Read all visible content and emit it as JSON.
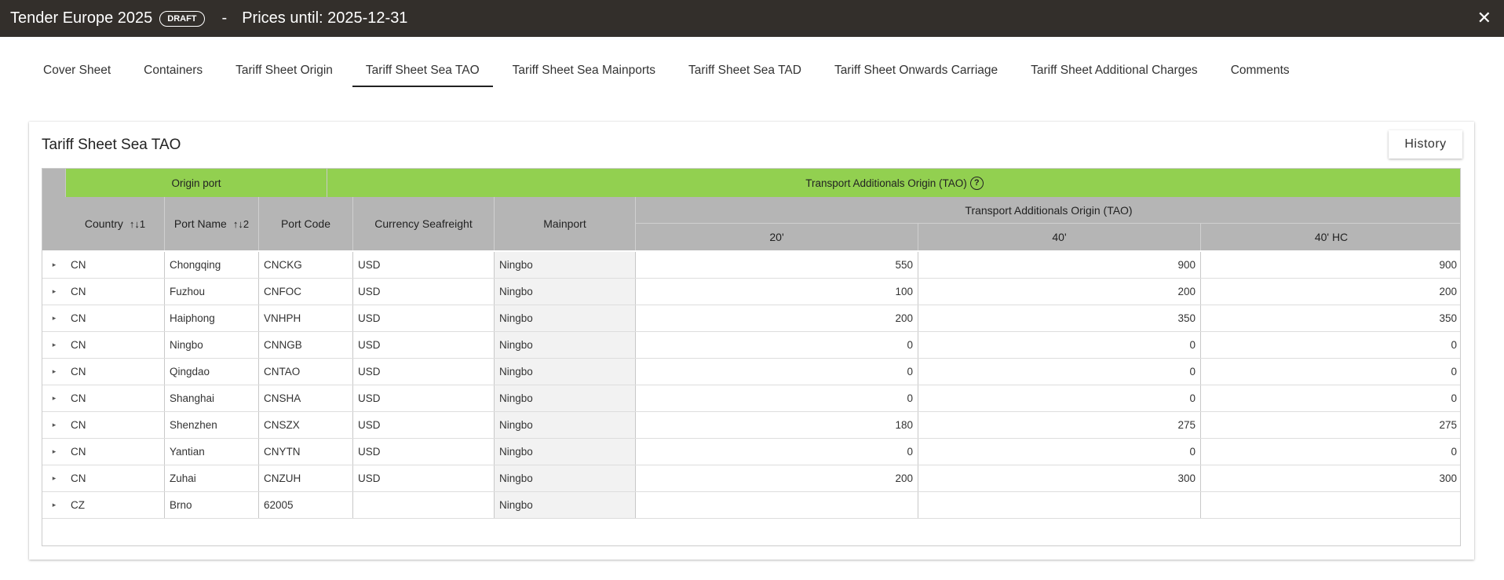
{
  "header": {
    "title": "Tender Europe 2025",
    "badge": "DRAFT",
    "separator": "-",
    "prices": "Prices until: 2025-12-31",
    "close_icon": "close-icon"
  },
  "tabs": [
    {
      "label": "Cover Sheet"
    },
    {
      "label": "Containers"
    },
    {
      "label": "Tariff Sheet Origin"
    },
    {
      "label": "Tariff Sheet Sea TAO",
      "active": true
    },
    {
      "label": "Tariff Sheet Sea Mainports"
    },
    {
      "label": "Tariff Sheet Sea TAD"
    },
    {
      "label": "Tariff Sheet Onwards Carriage"
    },
    {
      "label": "Tariff Sheet Additional Charges"
    },
    {
      "label": "Comments"
    }
  ],
  "card": {
    "title": "Tariff Sheet Sea TAO",
    "history_label": "History"
  },
  "table": {
    "group_origin": "Origin port",
    "group_tao": "Transport Additionals Origin (TAO)",
    "col_country": "Country",
    "col_country_sort": "↑↓1",
    "col_port_name": "Port Name",
    "col_port_name_sort": "↑↓2",
    "col_port_code": "Port Code",
    "col_currency": "Currency Seafreight",
    "col_mainport": "Mainport",
    "sub_group_tao": "Transport Additionals Origin (TAO)",
    "col_20": "20'",
    "col_40": "40'",
    "col_40hc": "40' HC",
    "rows": [
      {
        "country": "CN",
        "port": "Chongqing",
        "code": "CNCKG",
        "currency": "USD",
        "mainport": "Ningbo",
        "v20": "550",
        "v40": "900",
        "v40hc": "900"
      },
      {
        "country": "CN",
        "port": "Fuzhou",
        "code": "CNFOC",
        "currency": "USD",
        "mainport": "Ningbo",
        "v20": "100",
        "v40": "200",
        "v40hc": "200"
      },
      {
        "country": "CN",
        "port": "Haiphong",
        "code": "VNHPH",
        "currency": "USD",
        "mainport": "Ningbo",
        "v20": "200",
        "v40": "350",
        "v40hc": "350"
      },
      {
        "country": "CN",
        "port": "Ningbo",
        "code": "CNNGB",
        "currency": "USD",
        "mainport": "Ningbo",
        "v20": "0",
        "v40": "0",
        "v40hc": "0"
      },
      {
        "country": "CN",
        "port": "Qingdao",
        "code": "CNTAO",
        "currency": "USD",
        "mainport": "Ningbo",
        "v20": "0",
        "v40": "0",
        "v40hc": "0"
      },
      {
        "country": "CN",
        "port": "Shanghai",
        "code": "CNSHA",
        "currency": "USD",
        "mainport": "Ningbo",
        "v20": "0",
        "v40": "0",
        "v40hc": "0"
      },
      {
        "country": "CN",
        "port": "Shenzhen",
        "code": "CNSZX",
        "currency": "USD",
        "mainport": "Ningbo",
        "v20": "180",
        "v40": "275",
        "v40hc": "275"
      },
      {
        "country": "CN",
        "port": "Yantian",
        "code": "CNYTN",
        "currency": "USD",
        "mainport": "Ningbo",
        "v20": "0",
        "v40": "0",
        "v40hc": "0"
      },
      {
        "country": "CN",
        "port": "Zuhai",
        "code": "CNZUH",
        "currency": "USD",
        "mainport": "Ningbo",
        "v20": "200",
        "v40": "300",
        "v40hc": "300"
      },
      {
        "country": "CZ",
        "port": "Brno",
        "code": "62005",
        "currency": "",
        "mainport": "Ningbo",
        "v20": "",
        "v40": "",
        "v40hc": ""
      }
    ]
  }
}
